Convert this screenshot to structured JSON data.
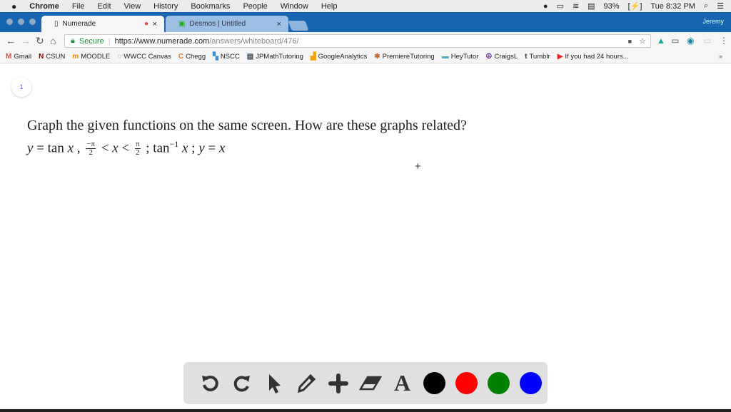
{
  "menubar": {
    "app": "Chrome",
    "items": [
      "File",
      "Edit",
      "View",
      "History",
      "Bookmarks",
      "People",
      "Window",
      "Help"
    ],
    "battery": "93%",
    "clock": "Tue 8:32 PM"
  },
  "tabs": [
    {
      "label": "Numerade",
      "active": true
    },
    {
      "label": "Desmos | Untitled",
      "active": false
    }
  ],
  "tabbar": {
    "user": "Jeremy"
  },
  "address": {
    "secure_label": "Secure",
    "url_host": "https://www.numerade.com",
    "url_path": "/answers/whiteboard/476/"
  },
  "bookmarks": [
    {
      "label": "Gmail",
      "icon": "M",
      "color": "#d44"
    },
    {
      "label": "CSUN",
      "icon": "N",
      "color": "#a00"
    },
    {
      "label": "MOODLE",
      "icon": "m",
      "color": "#e80"
    },
    {
      "label": "WWCC Canvas",
      "icon": "◌",
      "color": "#c33"
    },
    {
      "label": "Chegg",
      "icon": "C",
      "color": "#e87a1d"
    },
    {
      "label": "NSCC",
      "icon": "▚",
      "color": "#3a8fd8"
    },
    {
      "label": "JPMathTutoring",
      "icon": "▤",
      "color": "#345"
    },
    {
      "label": "GoogleAnalytics",
      "icon": "▟",
      "color": "#f4a300"
    },
    {
      "label": "PremiereTutoring",
      "icon": "✱",
      "color": "#c63"
    },
    {
      "label": "HeyTutor",
      "icon": "▬",
      "color": "#5ab"
    },
    {
      "label": "CraigsL",
      "icon": "☮",
      "color": "#639"
    },
    {
      "label": "Tumblr",
      "icon": "t",
      "color": "#333"
    },
    {
      "label": "If you had 24 hours...",
      "icon": "▶",
      "color": "#e22"
    }
  ],
  "page": {
    "number": "1",
    "question": "Graph the given functions on the same screen. How are these graphs related?",
    "math": {
      "p1": "y",
      "p2": " = tan ",
      "p3": "x",
      "p4": " , ",
      "f1num": "−π",
      "f1den": "2",
      "p5": " < ",
      "p6": "x",
      "p7": " < ",
      "f2num": "π",
      "f2den": "2",
      "p8": " ; tan",
      "sup": "−1",
      "p9": " x",
      "p10": " ; ",
      "p11": "y",
      "p12": " = ",
      "p13": "x"
    }
  },
  "toolbar": {
    "tools": [
      "undo-icon",
      "redo-icon",
      "pointer-icon",
      "pencil-icon",
      "plus-icon",
      "eraser-icon",
      "text-icon"
    ],
    "text_tool_label": "A",
    "colors": [
      "#000000",
      "#ff0000",
      "#008000",
      "#0000ff"
    ]
  }
}
